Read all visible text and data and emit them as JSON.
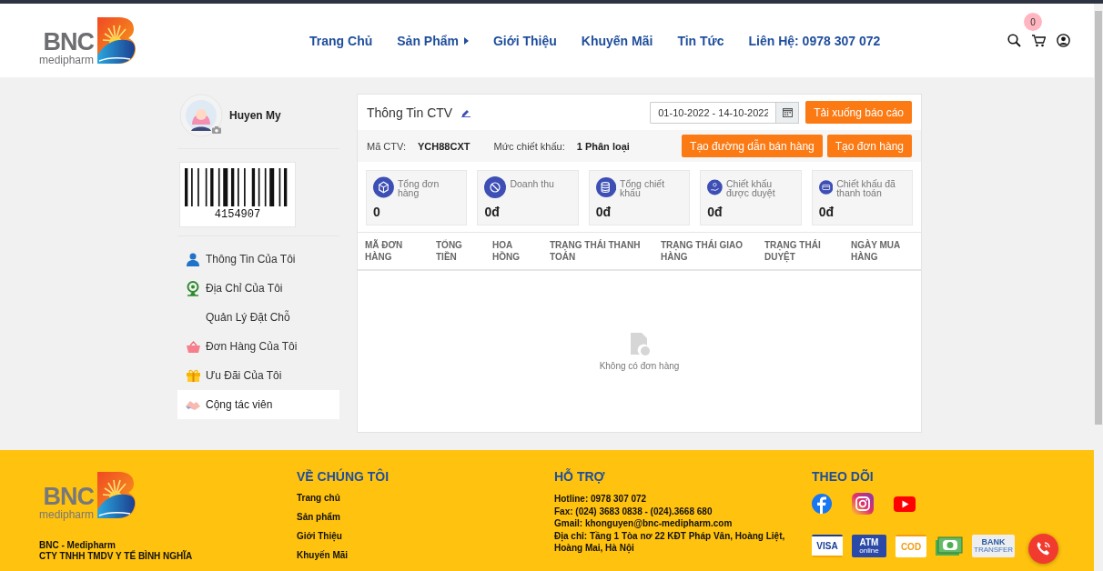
{
  "header": {
    "logo": {
      "brand": "BNC",
      "tagline": "medipharm"
    },
    "nav": [
      {
        "label": "Trang Chủ",
        "has_submenu": false
      },
      {
        "label": "Sản Phẩm",
        "has_submenu": true
      },
      {
        "label": "Giới Thiệu",
        "has_submenu": false
      },
      {
        "label": "Khuyến Mãi",
        "has_submenu": false
      },
      {
        "label": "Tin Tức",
        "has_submenu": false
      },
      {
        "label": "Liên Hệ: 0978 307 072",
        "has_submenu": false
      }
    ],
    "cart_count": "0"
  },
  "profile": {
    "name": "Huyen My",
    "barcode": "4154907"
  },
  "menu": [
    {
      "label": "Thông Tin Của Tôi",
      "kind": "profile",
      "selected": false
    },
    {
      "label": "Địa Chỉ Của Tôi",
      "kind": "address",
      "selected": false
    },
    {
      "label": "Quản Lý Đặt Chỗ",
      "kind": "booking",
      "selected": false
    },
    {
      "label": "Đơn Hàng Của Tôi",
      "kind": "orders",
      "selected": false
    },
    {
      "label": "Ưu Đãi Của Tôi",
      "kind": "offers",
      "selected": false
    },
    {
      "label": "Cộng tác viên",
      "kind": "affiliate",
      "selected": true
    }
  ],
  "panel": {
    "title": "Thông Tin CTV",
    "date_range": "01-10-2022 - 14-10-2022",
    "download_button": "Tải xuống báo cáo",
    "code_label": "Mã CTV:",
    "code": "YCH88CXT",
    "discount_label": "Mức chiết khấu:",
    "discount": "1 Phân loại",
    "buttons": [
      "Tạo đường dẫn bán hàng",
      "Tạo đơn hàng"
    ],
    "stats": [
      {
        "label": "Tổng đơn hàng",
        "value": "0"
      },
      {
        "label": "Doanh thu",
        "value": "0đ"
      },
      {
        "label": "Tổng chiết khấu",
        "value": "0đ"
      },
      {
        "label": "Chiết khấu được duyệt",
        "value": "0đ"
      },
      {
        "label": "Chiết khấu đã thanh toán",
        "value": "0đ"
      }
    ],
    "table": {
      "columns": [
        "MÃ ĐƠN HÀNG",
        "TỔNG TIỀN",
        "HOA HỒNG",
        "TRẠNG THÁI THANH TOÁN",
        "TRẠNG THÁI GIAO HÀNG",
        "TRẠNG THÁI DUYỆT",
        "NGÀY MUA HÀNG"
      ],
      "empty_text": "Không có đơn hàng"
    }
  },
  "footer": {
    "logo": {
      "brand": "BNC",
      "tagline": "medipharm"
    },
    "company": [
      "BNC - Medipharm",
      "CTY TNHH TMDV Y TẾ BÌNH NGHĨA"
    ],
    "about": {
      "title": "VỀ CHÚNG TÔI",
      "links": [
        "Trang chủ",
        "Sản phẩm",
        "Giới Thiệu",
        "Khuyến Mãi"
      ]
    },
    "support": {
      "title": "HỖ TRỢ",
      "lines": [
        "Hotline: 0978 307 072",
        "Fax: (024) 3683 0838 - (024).3668 680",
        "Gmail: khonguyen@bnc-medipharm.com",
        "Địa chỉ: Tầng 1 Tòa nơ 22 KĐT Pháp Vân, Hoàng Liệt, Hoàng Mai, Hà Nội"
      ]
    },
    "follow": {
      "title": "THEO DÕI",
      "payments": [
        {
          "kind": "visa",
          "label": "VISA"
        },
        {
          "kind": "atm",
          "label": "ATM",
          "sublabel": "online"
        },
        {
          "kind": "cod",
          "label": "COD"
        },
        {
          "kind": "cash"
        },
        {
          "kind": "bank",
          "label": "BANK",
          "sublabel": "TRANSFER"
        }
      ]
    }
  }
}
